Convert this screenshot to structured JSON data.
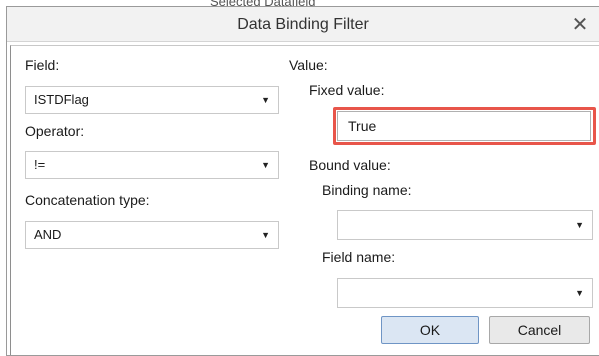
{
  "backdrop_text": "Selected Datafield",
  "dialog": {
    "title": "Data Binding Filter",
    "close_glyph": "✕"
  },
  "left": {
    "field_label": "Field:",
    "field_value": "ISTDFlag",
    "operator_label": "Operator:",
    "operator_value": "!=",
    "concat_label": "Concatenation type:",
    "concat_value": "AND"
  },
  "right": {
    "value_label": "Value:",
    "fixed_label": "Fixed value:",
    "fixed_value": "True",
    "bound_label": "Bound value:",
    "binding_name_label": "Binding name:",
    "binding_name_value": "",
    "field_name_label": "Field name:",
    "field_name_value": ""
  },
  "buttons": {
    "ok": "OK",
    "cancel": "Cancel"
  },
  "icons": {
    "dropdown": "chevron-down-icon",
    "close": "close-icon"
  },
  "colors": {
    "highlight": "#e8554a",
    "ok_button_bg": "#dbe6f3"
  }
}
